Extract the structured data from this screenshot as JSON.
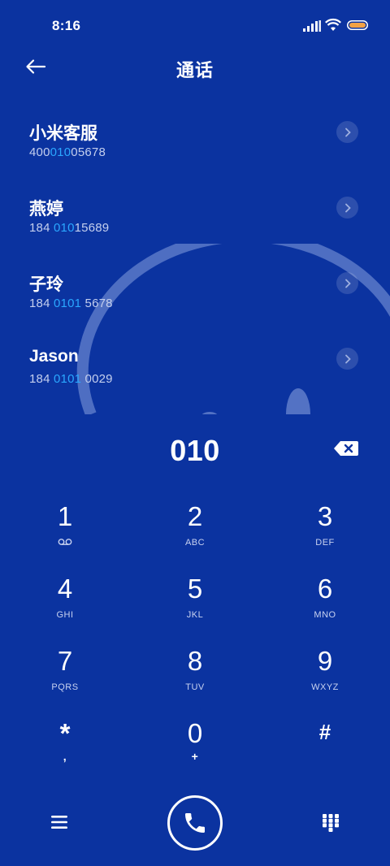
{
  "status_bar": {
    "time": "8:16",
    "icons": [
      "signal-icon",
      "wifi-icon",
      "battery-icon"
    ]
  },
  "header": {
    "title": "通话",
    "back_icon": "arrow-left-icon"
  },
  "colors": {
    "background": "#0b33a0",
    "highlight": "#2aa7ff",
    "text": "#ffffff",
    "secondary_text": "#c4cfee"
  },
  "contacts": [
    {
      "name": "小米客服",
      "number_parts": [
        "400",
        "010",
        "05678"
      ]
    },
    {
      "name": "燕婷",
      "number_parts": [
        "184 ",
        "010",
        "15689"
      ]
    },
    {
      "name": "子玲",
      "number_parts": [
        "184 ",
        "0101",
        " 5678"
      ]
    },
    {
      "name": "Jason",
      "number_parts": [
        "184 ",
        "0101",
        " 0029"
      ]
    }
  ],
  "dial": {
    "typed_number": "010",
    "backspace_icon": "backspace-icon"
  },
  "keypad": [
    {
      "digit": "1",
      "sub": "",
      "sub_icon": "voicemail-icon"
    },
    {
      "digit": "2",
      "sub": "ABC"
    },
    {
      "digit": "3",
      "sub": "DEF"
    },
    {
      "digit": "4",
      "sub": "GHI"
    },
    {
      "digit": "5",
      "sub": "JKL"
    },
    {
      "digit": "6",
      "sub": "MNO"
    },
    {
      "digit": "7",
      "sub": "PQRS"
    },
    {
      "digit": "8",
      "sub": "TUV"
    },
    {
      "digit": "9",
      "sub": "WXYZ"
    },
    {
      "digit": "*",
      "sub": ","
    },
    {
      "digit": "0",
      "sub": "+"
    },
    {
      "digit": "#",
      "sub": ""
    }
  ],
  "bottom_bar": {
    "menu_icon": "menu-icon",
    "call_icon": "phone-icon",
    "dialpad_icon": "dialpad-icon"
  }
}
